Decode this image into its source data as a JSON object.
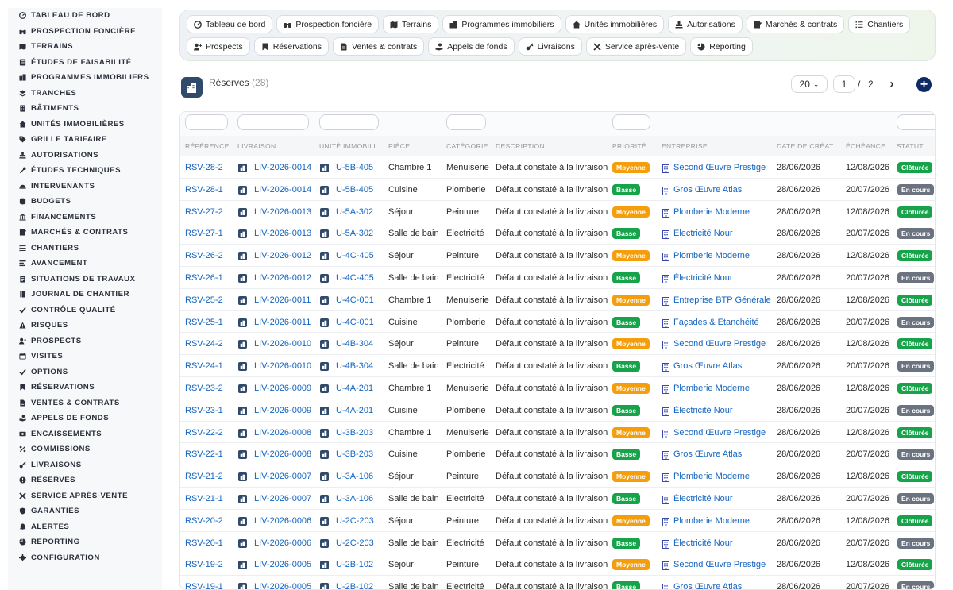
{
  "colors": {
    "accent": "#1565c0",
    "brand_dark": "#2f4a6b",
    "priority_moyenne": "#f59e0b",
    "priority_basse": "#16a34a",
    "status_cloturee": "#16a34a",
    "status_en_cours": "#6b7280"
  },
  "sidebar": {
    "items": [
      {
        "label": "TABLEAU DE BORD",
        "icon": "dashboard-icon"
      },
      {
        "label": "PROSPECTION FONCIÈRE",
        "icon": "binoculars-icon"
      },
      {
        "label": "TERRAINS",
        "icon": "map-icon"
      },
      {
        "label": "ÉTUDES DE FAISABILITÉ",
        "icon": "study-icon"
      },
      {
        "label": "PROGRAMMES IMMOBILIERS",
        "icon": "buildings-icon"
      },
      {
        "label": "TRANCHES",
        "icon": "layers-icon"
      },
      {
        "label": "BÂTIMENTS",
        "icon": "building-icon"
      },
      {
        "label": "UNITÉS IMMOBILIÈRES",
        "icon": "home-icon"
      },
      {
        "label": "GRILLE TARIFAIRE",
        "icon": "tag-icon"
      },
      {
        "label": "AUTORISATIONS",
        "icon": "stamp-icon"
      },
      {
        "label": "ÉTUDES TECHNIQUES",
        "icon": "tools-icon"
      },
      {
        "label": "INTERVENANTS",
        "icon": "helmet-icon"
      },
      {
        "label": "BUDGETS",
        "icon": "coins-icon"
      },
      {
        "label": "FINANCEMENTS",
        "icon": "bank-icon"
      },
      {
        "label": "MARCHÉS & CONTRATS",
        "icon": "contract-icon"
      },
      {
        "label": "CHANTIERS",
        "icon": "list-icon"
      },
      {
        "label": "AVANCEMENT",
        "icon": "progress-icon"
      },
      {
        "label": "SITUATIONS DE TRAVAUX",
        "icon": "invoice-icon"
      },
      {
        "label": "JOURNAL DE CHANTIER",
        "icon": "journal-icon"
      },
      {
        "label": "CONTRÔLE QUALITÉ",
        "icon": "check-icon"
      },
      {
        "label": "RISQUES",
        "icon": "warning-icon"
      },
      {
        "label": "PROSPECTS",
        "icon": "user-plus-icon"
      },
      {
        "label": "VISITES",
        "icon": "calendar-icon"
      },
      {
        "label": "OPTIONS",
        "icon": "options-icon"
      },
      {
        "label": "RÉSERVATIONS",
        "icon": "bookmark-icon"
      },
      {
        "label": "VENTES & CONTRATS",
        "icon": "file-icon"
      },
      {
        "label": "APPELS DE FONDS",
        "icon": "hand-coin-icon"
      },
      {
        "label": "ENCAISSEMENTS",
        "icon": "cash-icon"
      },
      {
        "label": "COMMISSIONS",
        "icon": "percent-icon"
      },
      {
        "label": "LIVRAISONS",
        "icon": "key-icon"
      },
      {
        "label": "RÉSERVES",
        "icon": "alert-circle-icon"
      },
      {
        "label": "SERVICE APRÈS-VENTE",
        "icon": "wrench-icon"
      },
      {
        "label": "GARANTIES",
        "icon": "shield-icon"
      },
      {
        "label": "ALERTES",
        "icon": "bell-icon"
      },
      {
        "label": "REPORTING",
        "icon": "chart-pie-icon"
      },
      {
        "label": "CONFIGURATION",
        "icon": "gear-icon"
      }
    ]
  },
  "quicknav": {
    "row1": [
      {
        "label": "Tableau de bord",
        "icon": "dashboard-icon"
      },
      {
        "label": "Prospection foncière",
        "icon": "binoculars-icon"
      },
      {
        "label": "Terrains",
        "icon": "map-icon"
      },
      {
        "label": "Programmes immobiliers",
        "icon": "buildings-icon"
      },
      {
        "label": "Unités immobilières",
        "icon": "home-icon"
      },
      {
        "label": "Autorisations",
        "icon": "stamp-icon"
      },
      {
        "label": "Marchés & contrats",
        "icon": "contract-icon"
      },
      {
        "label": "Chantiers",
        "icon": "list-icon"
      }
    ],
    "row2": [
      {
        "label": "Prospects",
        "icon": "user-plus-icon"
      },
      {
        "label": "Réservations",
        "icon": "bookmark-icon"
      },
      {
        "label": "Ventes & contrats",
        "icon": "file-icon"
      },
      {
        "label": "Appels de fonds",
        "icon": "hand-coin-icon"
      },
      {
        "label": "Livraisons",
        "icon": "key-icon"
      },
      {
        "label": "Service après-vente",
        "icon": "wrench-icon"
      },
      {
        "label": "Reporting",
        "icon": "chart-pie-icon"
      }
    ]
  },
  "list": {
    "title": "Réserves",
    "count": "(28)",
    "icon": "buildings-icon"
  },
  "pagination": {
    "page_size": "20",
    "current_page": "1",
    "separator": "/",
    "total_pages": "2",
    "next_label": "›",
    "add_label": "+"
  },
  "table": {
    "columns": [
      "RÉFÉRENCE",
      "LIVRAISON",
      "UNITÉ IMMOBILIÈRE",
      "PIÈCE",
      "CATÉGORIE",
      "DESCRIPTION",
      "PRIORITÉ",
      "ENTREPRISE",
      "DATE DE CRÉATION",
      "ÉCHÉANCE",
      "STATUT DE LA RÉSERVE"
    ],
    "rows": [
      {
        "ref": "RSV-28-2",
        "livraison": "LIV-2026-0014",
        "unite": "U-5B-405",
        "piece": "Chambre 1",
        "categorie": "Menuiserie",
        "description": "Défaut constaté à la livraison",
        "priorite": "Moyenne",
        "entreprise": "Second Œuvre Prestige",
        "date_creation": "28/06/2026",
        "echeance": "12/08/2026",
        "statut": "Clôturée"
      },
      {
        "ref": "RSV-28-1",
        "livraison": "LIV-2026-0014",
        "unite": "U-5B-405",
        "piece": "Cuisine",
        "categorie": "Plomberie",
        "description": "Défaut constaté à la livraison",
        "priorite": "Basse",
        "entreprise": "Gros Œuvre Atlas",
        "date_creation": "28/06/2026",
        "echeance": "20/07/2026",
        "statut": "En cours"
      },
      {
        "ref": "RSV-27-2",
        "livraison": "LIV-2026-0013",
        "unite": "U-5A-302",
        "piece": "Séjour",
        "categorie": "Peinture",
        "description": "Défaut constaté à la livraison",
        "priorite": "Moyenne",
        "entreprise": "Plomberie Moderne",
        "date_creation": "28/06/2026",
        "echeance": "12/08/2026",
        "statut": "Clôturée"
      },
      {
        "ref": "RSV-27-1",
        "livraison": "LIV-2026-0013",
        "unite": "U-5A-302",
        "piece": "Salle de bain",
        "categorie": "Électricité",
        "description": "Défaut constaté à la livraison",
        "priorite": "Basse",
        "entreprise": "Électricité Nour",
        "date_creation": "28/06/2026",
        "echeance": "20/07/2026",
        "statut": "En cours"
      },
      {
        "ref": "RSV-26-2",
        "livraison": "LIV-2026-0012",
        "unite": "U-4C-405",
        "piece": "Séjour",
        "categorie": "Peinture",
        "description": "Défaut constaté à la livraison",
        "priorite": "Moyenne",
        "entreprise": "Plomberie Moderne",
        "date_creation": "28/06/2026",
        "echeance": "12/08/2026",
        "statut": "Clôturée"
      },
      {
        "ref": "RSV-26-1",
        "livraison": "LIV-2026-0012",
        "unite": "U-4C-405",
        "piece": "Salle de bain",
        "categorie": "Électricité",
        "description": "Défaut constaté à la livraison",
        "priorite": "Basse",
        "entreprise": "Électricité Nour",
        "date_creation": "28/06/2026",
        "echeance": "20/07/2026",
        "statut": "En cours"
      },
      {
        "ref": "RSV-25-2",
        "livraison": "LIV-2026-0011",
        "unite": "U-4C-001",
        "piece": "Chambre 1",
        "categorie": "Menuiserie",
        "description": "Défaut constaté à la livraison",
        "priorite": "Moyenne",
        "entreprise": "Entreprise BTP Générale",
        "date_creation": "28/06/2026",
        "echeance": "12/08/2026",
        "statut": "Clôturée"
      },
      {
        "ref": "RSV-25-1",
        "livraison": "LIV-2026-0011",
        "unite": "U-4C-001",
        "piece": "Cuisine",
        "categorie": "Plomberie",
        "description": "Défaut constaté à la livraison",
        "priorite": "Basse",
        "entreprise": "Façades & Étanchéité",
        "date_creation": "28/06/2026",
        "echeance": "20/07/2026",
        "statut": "En cours"
      },
      {
        "ref": "RSV-24-2",
        "livraison": "LIV-2026-0010",
        "unite": "U-4B-304",
        "piece": "Séjour",
        "categorie": "Peinture",
        "description": "Défaut constaté à la livraison",
        "priorite": "Moyenne",
        "entreprise": "Second Œuvre Prestige",
        "date_creation": "28/06/2026",
        "echeance": "12/08/2026",
        "statut": "Clôturée"
      },
      {
        "ref": "RSV-24-1",
        "livraison": "LIV-2026-0010",
        "unite": "U-4B-304",
        "piece": "Salle de bain",
        "categorie": "Électricité",
        "description": "Défaut constaté à la livraison",
        "priorite": "Basse",
        "entreprise": "Gros Œuvre Atlas",
        "date_creation": "28/06/2026",
        "echeance": "20/07/2026",
        "statut": "En cours"
      },
      {
        "ref": "RSV-23-2",
        "livraison": "LIV-2026-0009",
        "unite": "U-4A-201",
        "piece": "Chambre 1",
        "categorie": "Menuiserie",
        "description": "Défaut constaté à la livraison",
        "priorite": "Moyenne",
        "entreprise": "Plomberie Moderne",
        "date_creation": "28/06/2026",
        "echeance": "12/08/2026",
        "statut": "Clôturée"
      },
      {
        "ref": "RSV-23-1",
        "livraison": "LIV-2026-0009",
        "unite": "U-4A-201",
        "piece": "Cuisine",
        "categorie": "Plomberie",
        "description": "Défaut constaté à la livraison",
        "priorite": "Basse",
        "entreprise": "Électricité Nour",
        "date_creation": "28/06/2026",
        "echeance": "20/07/2026",
        "statut": "En cours"
      },
      {
        "ref": "RSV-22-2",
        "livraison": "LIV-2026-0008",
        "unite": "U-3B-203",
        "piece": "Chambre 1",
        "categorie": "Menuiserie",
        "description": "Défaut constaté à la livraison",
        "priorite": "Moyenne",
        "entreprise": "Second Œuvre Prestige",
        "date_creation": "28/06/2026",
        "echeance": "12/08/2026",
        "statut": "Clôturée"
      },
      {
        "ref": "RSV-22-1",
        "livraison": "LIV-2026-0008",
        "unite": "U-3B-203",
        "piece": "Cuisine",
        "categorie": "Plomberie",
        "description": "Défaut constaté à la livraison",
        "priorite": "Basse",
        "entreprise": "Gros Œuvre Atlas",
        "date_creation": "28/06/2026",
        "echeance": "20/07/2026",
        "statut": "En cours"
      },
      {
        "ref": "RSV-21-2",
        "livraison": "LIV-2026-0007",
        "unite": "U-3A-106",
        "piece": "Séjour",
        "categorie": "Peinture",
        "description": "Défaut constaté à la livraison",
        "priorite": "Moyenne",
        "entreprise": "Plomberie Moderne",
        "date_creation": "28/06/2026",
        "echeance": "12/08/2026",
        "statut": "Clôturée"
      },
      {
        "ref": "RSV-21-1",
        "livraison": "LIV-2026-0007",
        "unite": "U-3A-106",
        "piece": "Salle de bain",
        "categorie": "Électricité",
        "description": "Défaut constaté à la livraison",
        "priorite": "Basse",
        "entreprise": "Électricité Nour",
        "date_creation": "28/06/2026",
        "echeance": "20/07/2026",
        "statut": "En cours"
      },
      {
        "ref": "RSV-20-2",
        "livraison": "LIV-2026-0006",
        "unite": "U-2C-203",
        "piece": "Séjour",
        "categorie": "Peinture",
        "description": "Défaut constaté à la livraison",
        "priorite": "Moyenne",
        "entreprise": "Plomberie Moderne",
        "date_creation": "28/06/2026",
        "echeance": "12/08/2026",
        "statut": "Clôturée"
      },
      {
        "ref": "RSV-20-1",
        "livraison": "LIV-2026-0006",
        "unite": "U-2C-203",
        "piece": "Salle de bain",
        "categorie": "Électricité",
        "description": "Défaut constaté à la livraison",
        "priorite": "Basse",
        "entreprise": "Électricité Nour",
        "date_creation": "28/06/2026",
        "echeance": "20/07/2026",
        "statut": "En cours"
      },
      {
        "ref": "RSV-19-2",
        "livraison": "LIV-2026-0005",
        "unite": "U-2B-102",
        "piece": "Séjour",
        "categorie": "Peinture",
        "description": "Défaut constaté à la livraison",
        "priorite": "Moyenne",
        "entreprise": "Second Œuvre Prestige",
        "date_creation": "28/06/2026",
        "echeance": "12/08/2026",
        "statut": "Clôturée"
      },
      {
        "ref": "RSV-19-1",
        "livraison": "LIV-2026-0005",
        "unite": "U-2B-102",
        "piece": "Salle de bain",
        "categorie": "Électricité",
        "description": "Défaut constaté à la livraison",
        "priorite": "Basse",
        "entreprise": "Gros Œuvre Atlas",
        "date_creation": "28/06/2026",
        "echeance": "20/07/2026",
        "statut": "En cours"
      }
    ]
  }
}
